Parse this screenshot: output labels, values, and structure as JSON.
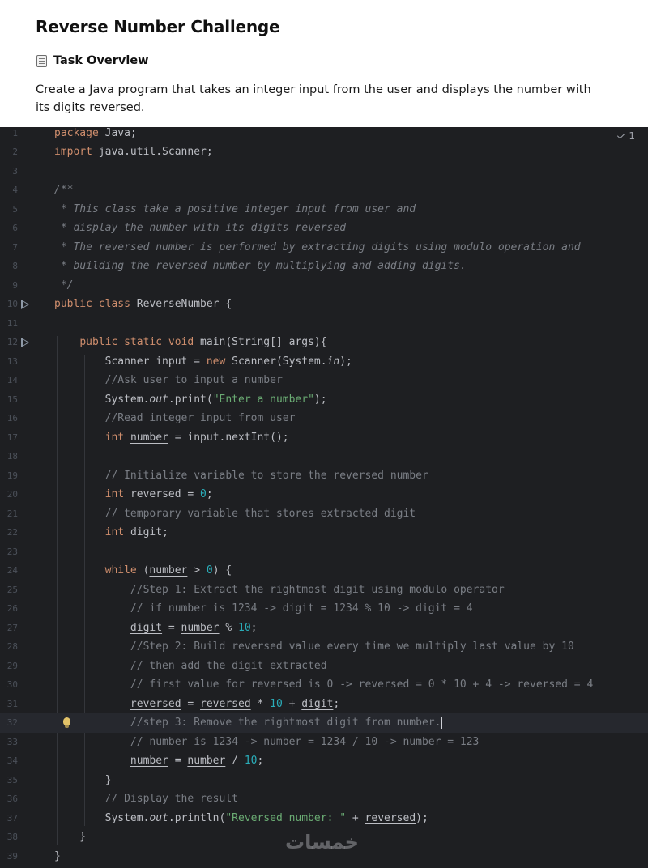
{
  "page": {
    "title": "Reverse Number Challenge",
    "overview_label": "Task Overview",
    "overview_icon": "memo-icon",
    "description": "Create a Java program that takes an integer input from the user and displays the number with its digits reversed."
  },
  "editor": {
    "inspection_count": "1",
    "inspection_icon": "check-icon",
    "watermark": "خمسات",
    "colors": {
      "background": "#1e1f22",
      "keyword": "#cf8e6d",
      "comment": "#7a7e85",
      "string": "#6aab73",
      "number": "#2aacb8",
      "text": "#bcbec4"
    },
    "lines": [
      {
        "n": "1",
        "code": "package Java;"
      },
      {
        "n": "2",
        "code": "import java.util.Scanner;"
      },
      {
        "n": "3",
        "code": ""
      },
      {
        "n": "4",
        "code": "/**"
      },
      {
        "n": "5",
        "code": " * This class take a positive integer input from user and"
      },
      {
        "n": "6",
        "code": " * display the number with its digits reversed"
      },
      {
        "n": "7",
        "code": " * The reversed number is performed by extracting digits using modulo operation and"
      },
      {
        "n": "8",
        "code": " * building the reversed number by multiplying and adding digits."
      },
      {
        "n": "9",
        "code": " */"
      },
      {
        "n": "10",
        "code": "public class ReverseNumber {",
        "run": true
      },
      {
        "n": "11",
        "code": ""
      },
      {
        "n": "12",
        "code": "    public static void main(String[] args){",
        "run": true
      },
      {
        "n": "13",
        "code": "        Scanner input = new Scanner(System.in);"
      },
      {
        "n": "14",
        "code": "        //Ask user to input a number"
      },
      {
        "n": "15",
        "code": "        System.out.print(\"Enter a number\");"
      },
      {
        "n": "16",
        "code": "        //Read integer input from user"
      },
      {
        "n": "17",
        "code": "        int number = input.nextInt();"
      },
      {
        "n": "18",
        "code": ""
      },
      {
        "n": "19",
        "code": "        // Initialize variable to store the reversed number"
      },
      {
        "n": "20",
        "code": "        int reversed = 0;"
      },
      {
        "n": "21",
        "code": "        // temporary variable that stores extracted digit"
      },
      {
        "n": "22",
        "code": "        int digit;"
      },
      {
        "n": "23",
        "code": ""
      },
      {
        "n": "24",
        "code": "        while (number > 0) {"
      },
      {
        "n": "25",
        "code": "            //Step 1: Extract the rightmost digit using modulo operator"
      },
      {
        "n": "26",
        "code": "            // if number is 1234 -> digit = 1234 % 10 -> digit = 4"
      },
      {
        "n": "27",
        "code": "            digit = number % 10;"
      },
      {
        "n": "28",
        "code": "            //Step 2: Build reversed value every time we multiply last value by 10"
      },
      {
        "n": "29",
        "code": "            // then add the digit extracted"
      },
      {
        "n": "30",
        "code": "            // first value for reversed is 0 -> reversed = 0 * 10 + 4 -> reversed = 4"
      },
      {
        "n": "31",
        "code": "            reversed = reversed * 10 + digit;"
      },
      {
        "n": "32",
        "code": "            //step 3: Remove the rightmost digit from number.",
        "current": true,
        "bulb": true
      },
      {
        "n": "33",
        "code": "            // number is 1234 -> number = 1234 / 10 -> number = 123"
      },
      {
        "n": "34",
        "code": "            number = number / 10;"
      },
      {
        "n": "35",
        "code": "        }"
      },
      {
        "n": "36",
        "code": "        // Display the result"
      },
      {
        "n": "37",
        "code": "        System.out.println(\"Reversed number: \" + reversed);"
      },
      {
        "n": "38",
        "code": "    }"
      },
      {
        "n": "39",
        "code": "}"
      }
    ]
  }
}
